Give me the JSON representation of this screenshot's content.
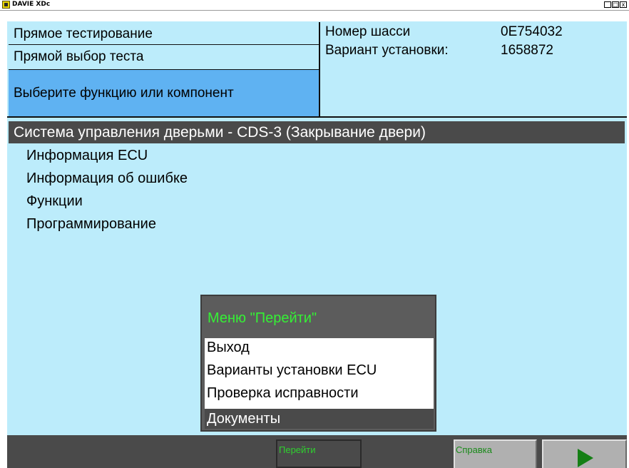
{
  "window": {
    "title": "DAVIE XDc",
    "minimize": "_",
    "maximize": "□",
    "close": "x"
  },
  "header": {
    "row1": "Прямое тестирование",
    "row2": "Прямой выбор теста",
    "prompt": "Выберите функцию или компонент",
    "chassis_label": "Номер шасси",
    "chassis_value": "0E754032",
    "variant_label": "Вариант установки:",
    "variant_value": "1658872"
  },
  "tree": {
    "selected": "Система управления дверьми - CDS-3 (Закрывание двери)",
    "items": [
      "Информация ECU",
      "Информация об ошибке",
      "Функции",
      "Программирование"
    ]
  },
  "popup": {
    "title": "Меню \"Перейти\"",
    "items": [
      "Выход",
      "Варианты установки ECU",
      "Проверка исправности"
    ],
    "selected": "Документы"
  },
  "footer": {
    "goto_label": "Перейти",
    "help_label": "Справка",
    "next_icon": "play-icon"
  },
  "colors": {
    "background": "#bcecfb",
    "prompt_bg": "#5fb2f2",
    "dark": "#4a4a4a",
    "popup_title": "#35f035",
    "play": "#157f15"
  }
}
